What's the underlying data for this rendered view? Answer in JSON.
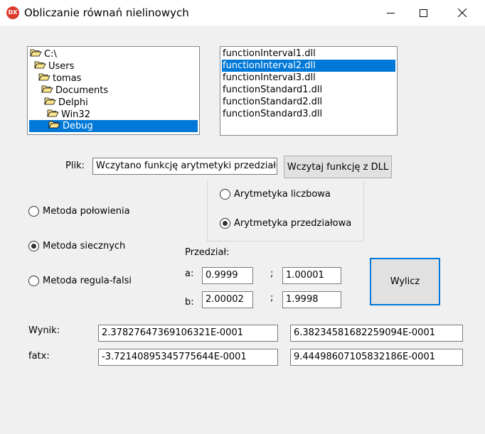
{
  "window": {
    "icon_label": "DX",
    "title": "Obliczanie równań nielinowych",
    "minimize_icon": "minimize-icon",
    "maximize_icon": "maximize-icon",
    "close_icon": "close-icon"
  },
  "directory_tree": {
    "items": [
      {
        "label": "C:\\",
        "selected": false
      },
      {
        "label": "Users",
        "selected": false
      },
      {
        "label": "tomas",
        "selected": false
      },
      {
        "label": "Documents",
        "selected": false
      },
      {
        "label": "Delphi",
        "selected": false
      },
      {
        "label": "Win32",
        "selected": false
      },
      {
        "label": "Debug",
        "selected": true
      }
    ]
  },
  "file_list": {
    "items": [
      {
        "label": "functionInterval1.dll",
        "selected": false
      },
      {
        "label": "functionInterval2.dll",
        "selected": true
      },
      {
        "label": "functionInterval3.dll",
        "selected": false
      },
      {
        "label": "functionStandard1.dll",
        "selected": false
      },
      {
        "label": "functionStandard2.dll",
        "selected": false
      },
      {
        "label": "functionStandard3.dll",
        "selected": false
      }
    ]
  },
  "file": {
    "label": "Plik:",
    "value": "Wczytano funkcję arytmetyki przedziałow",
    "load_button": "Wczytaj funkcję z DLL"
  },
  "arithmetic": {
    "options": [
      {
        "label": "Arytmetyka liczbowa",
        "checked": false
      },
      {
        "label": "Arytmetyka przedziałowa",
        "checked": true
      }
    ]
  },
  "methods": {
    "options": [
      {
        "label": "Metoda połowienia",
        "checked": false
      },
      {
        "label": "Metoda siecznych",
        "checked": true
      },
      {
        "label": "Metoda regula-falsi",
        "checked": false
      }
    ]
  },
  "interval": {
    "label": "Przedział:",
    "a_label": "a:",
    "b_label": "b:",
    "separator": ";",
    "a_left": "0.9999",
    "a_right": "1.00001",
    "b_left": "2.00002",
    "b_right": "1.9998"
  },
  "compute_button": "Wylicz",
  "result": {
    "wynik_label": "Wynik:",
    "fatx_label": "fatx:",
    "wynik_left": "2.37827647369106321E-0001",
    "wynik_right": "6.38234581682259094E-0001",
    "fatx_left": "-3.72140895345775644E-0001",
    "fatx_right": "9.44498607105832186E-0001"
  }
}
